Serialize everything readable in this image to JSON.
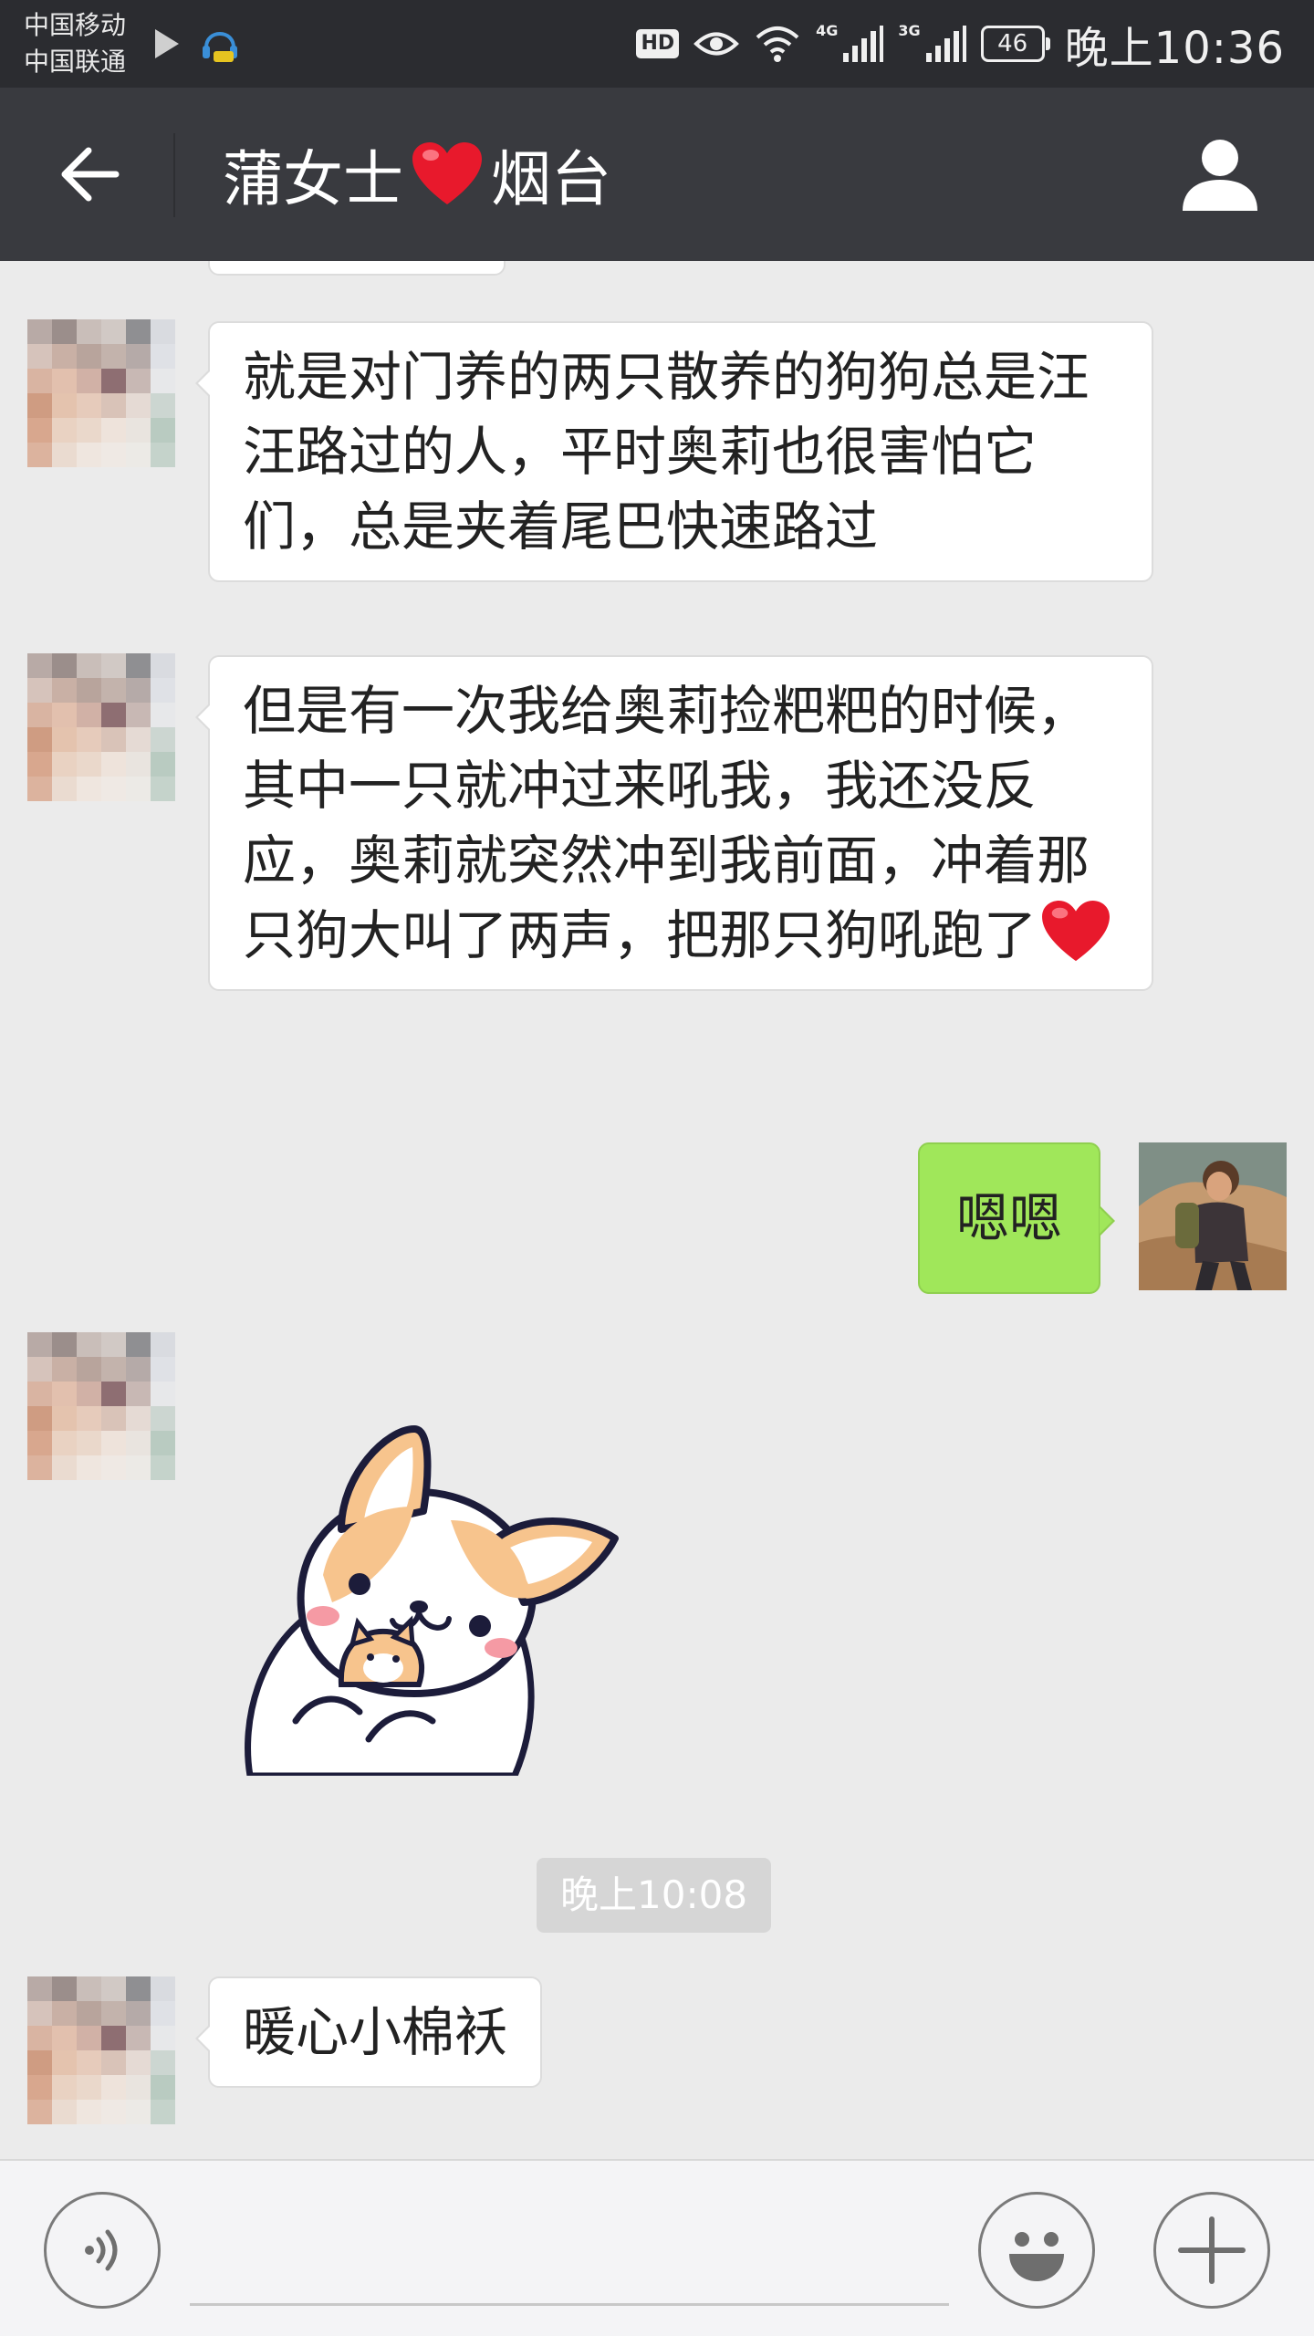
{
  "status_bar": {
    "carrier_1": "中国移动",
    "carrier_2": "中国联通",
    "hd": "HD",
    "net_1": "4G",
    "net_2": "3G",
    "battery": "46",
    "time": "晚上10:36"
  },
  "header": {
    "contact_name": "蒲女士",
    "contact_city": "烟台"
  },
  "messages": [
    {
      "from": "contact",
      "type": "text",
      "text": "就是对门养的两只散养的狗狗总是汪汪路过的人，平时奥莉也很害怕它们，总是夹着尾巴快速路过"
    },
    {
      "from": "contact",
      "type": "text",
      "text": "但是有一次我给奥莉捡粑粑的时候，其中一只就冲过来吼我，我还没反应，奥莉就突然冲到我前面，冲着那只狗大叫了两声，把那只狗吼跑了"
    },
    {
      "from": "me",
      "type": "text",
      "text": "嗯嗯"
    },
    {
      "from": "contact",
      "type": "sticker",
      "sticker": "corgi-hugging-corgi"
    },
    {
      "type": "timestamp",
      "text": "晚上10:08"
    },
    {
      "from": "contact",
      "type": "text",
      "text": "暖心小棉袄"
    }
  ],
  "icons": {
    "back": "arrow-left-icon",
    "profile": "person-icon",
    "voice": "voice-icon",
    "emoji": "smiley-icon",
    "more": "plus-icon",
    "heart_emoji": "red-heart-icon"
  },
  "colors": {
    "title_bar": "#393a3f",
    "status_bar": "#2b2c30",
    "chat_bg": "#ebebeb",
    "my_bubble": "#a0e75a",
    "their_bubble": "#ffffff",
    "heart": "#e8192c"
  }
}
